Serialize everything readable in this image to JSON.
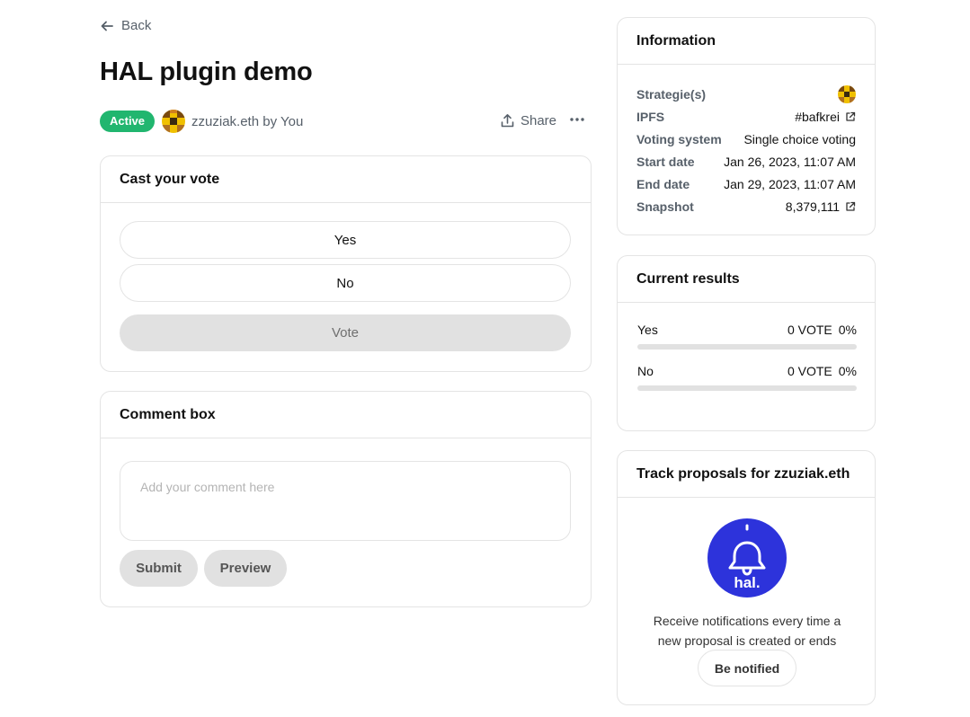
{
  "nav": {
    "back_label": "Back"
  },
  "proposal": {
    "title": "HAL plugin demo",
    "status": "Active",
    "author": "zzuziak.eth",
    "by_label": "by",
    "by_user": "You",
    "share_label": "Share"
  },
  "vote": {
    "heading": "Cast your vote",
    "choices": [
      "Yes",
      "No"
    ],
    "submit_label": "Vote"
  },
  "comment": {
    "heading": "Comment box",
    "placeholder": "Add your comment here",
    "submit_label": "Submit",
    "preview_label": "Preview"
  },
  "information": {
    "heading": "Information",
    "rows": [
      {
        "key": "Strategie(s)",
        "value": ""
      },
      {
        "key": "IPFS",
        "value": "#bafkrei"
      },
      {
        "key": "Voting system",
        "value": "Single choice voting"
      },
      {
        "key": "Start date",
        "value": "Jan 26, 2023, 11:07 AM"
      },
      {
        "key": "End date",
        "value": "Jan 29, 2023, 11:07 AM"
      },
      {
        "key": "Snapshot",
        "value": "8,379,111"
      }
    ]
  },
  "results": {
    "heading": "Current results",
    "items": [
      {
        "label": "Yes",
        "votes": "0 VOTE",
        "percent": "0%",
        "fraction": 0
      },
      {
        "label": "No",
        "votes": "0 VOTE",
        "percent": "0%",
        "fraction": 0
      }
    ]
  },
  "track": {
    "heading": "Track proposals for zzuziak.eth",
    "logo_text": "hal.",
    "description": "Receive notifications every time a new proposal is created or ends",
    "button_label": "Be notified"
  },
  "colors": {
    "active_badge": "#21b66f",
    "hal_brand": "#2d33db",
    "border": "#e4e4e4"
  },
  "icons": [
    "arrow-left-icon",
    "share-icon",
    "more-icon",
    "external-link-icon",
    "bell-icon",
    "avatar-icon"
  ]
}
